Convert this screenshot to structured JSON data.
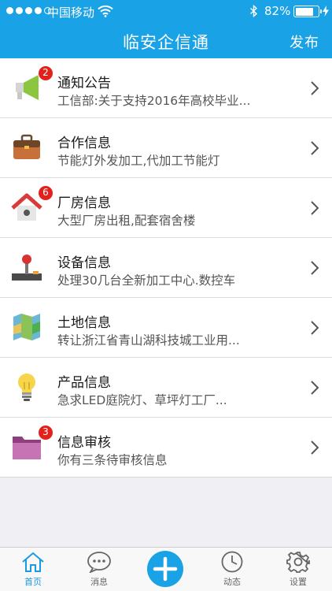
{
  "status_bar": {
    "carrier": "中国移动",
    "battery": "82%",
    "battery_level": 0.82
  },
  "nav": {
    "title": "临安企信通",
    "publish_label": "发布"
  },
  "items": [
    {
      "title": "通知公告",
      "subtitle": "工信部:关于支持2016年高校毕业...",
      "badge": "2",
      "icon": "megaphone-icon"
    },
    {
      "title": "合作信息",
      "subtitle": "节能灯外发加工,代加工节能灯",
      "badge": "",
      "icon": "briefcase-icon"
    },
    {
      "title": "厂房信息",
      "subtitle": "大型厂房出租,配套宿舍楼",
      "badge": "6",
      "icon": "house-icon"
    },
    {
      "title": "设备信息",
      "subtitle": "处理30几台全新加工中心.数控车",
      "badge": "",
      "icon": "joystick-icon"
    },
    {
      "title": "土地信息",
      "subtitle": "转让浙江省青山湖科技城工业用...",
      "badge": "",
      "icon": "map-icon"
    },
    {
      "title": "产品信息",
      "subtitle": "急求LED庭院灯、草坪灯工厂...",
      "badge": "",
      "icon": "lightbulb-icon"
    },
    {
      "title": "信息审核",
      "subtitle": "你有三条待审核信息",
      "badge": "3",
      "icon": "folder-icon"
    }
  ],
  "tabs": [
    {
      "label": "首页",
      "icon": "home-icon",
      "active": true
    },
    {
      "label": "消息",
      "icon": "chat-bubble-icon",
      "active": false
    },
    {
      "label": "",
      "icon": "plus-icon",
      "active": false
    },
    {
      "label": "动态",
      "icon": "clock-icon",
      "active": false
    },
    {
      "label": "设置",
      "icon": "gear-icon",
      "active": false
    }
  ],
  "colors": {
    "accent": "#1aa2e6",
    "badge": "#e2211c",
    "active_tab": "#1a9be0"
  }
}
